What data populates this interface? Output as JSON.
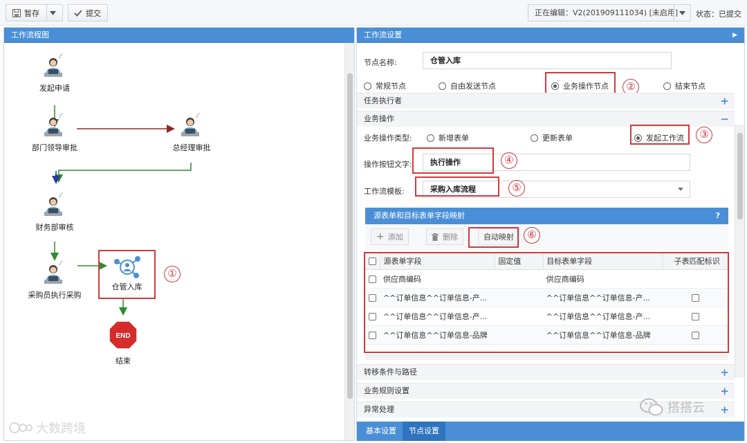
{
  "toolbar": {
    "save_label": "暂存",
    "submit_label": "提交",
    "version_label": "正在编辑：V2(201909111034) [未启用]",
    "status_label": "状态：已提交"
  },
  "flow_panel": {
    "title": "工作流程图",
    "nodes": {
      "start": "发起申请",
      "dept": "部门领导审批",
      "gm": "总经理审批",
      "finance": "财务部审核",
      "buyer": "采购员执行采购",
      "warehouse": "仓管入库",
      "end_label": "结束",
      "end_sign": "END"
    },
    "marker": "①"
  },
  "settings": {
    "title": "工作流设置",
    "node_name_label": "节点名称:",
    "node_name_value": "仓管入库",
    "node_types": [
      "常规节点",
      "自由发送节点",
      "业务操作节点",
      "结束节点"
    ],
    "node_type_selected": "业务操作节点",
    "section_executor": "任务执行者",
    "section_business": "业务操作",
    "op_type_label": "业务操作类型:",
    "op_types": [
      "新增表单",
      "更新表单",
      "发起工作流"
    ],
    "op_type_selected": "发起工作流",
    "btn_text_label": "操作按钮文字:",
    "btn_text_value": "执行操作",
    "template_label": "工作流模板:",
    "template_value": "采购入库流程",
    "mapping": {
      "title": "源表单和目标表单字段映射",
      "help": "?",
      "add": "添加",
      "delete": "删除",
      "auto_map": "自动映射",
      "columns": [
        "源表单字段",
        "固定值",
        "目标表单字段",
        "子表匹配标识"
      ],
      "rows": [
        {
          "source": "供应商编码",
          "fixed": "",
          "target": "供应商编码",
          "sub": false
        },
        {
          "source": "^^订单信息^^订单信息-产...",
          "fixed": "",
          "target": "^^订单信息^^订单信息-产...",
          "sub": true
        },
        {
          "source": "^^订单信息^^订单信息-产...",
          "fixed": "",
          "target": "^^订单信息^^订单信息-产...",
          "sub": true
        },
        {
          "source": "^^订单信息^^订单信息-品牌",
          "fixed": "",
          "target": "^^订单信息^^订单信息-品牌",
          "sub": true
        }
      ]
    },
    "section_transfer": "转移条件与路径",
    "section_rules": "业务规则设置",
    "section_exception": "异常处理",
    "tabs": [
      "基本设置",
      "节点设置"
    ],
    "markers": [
      "②",
      "③",
      "④",
      "⑤",
      "⑥"
    ]
  },
  "watermarks": {
    "right": "搭搭云",
    "left": "大数跨境"
  },
  "colors": {
    "header_blue": "#4a8fd6",
    "highlight_red": "#d0393d",
    "arrow_green": "#2e8b2e",
    "arrow_darkred": "#8b2a2a"
  }
}
